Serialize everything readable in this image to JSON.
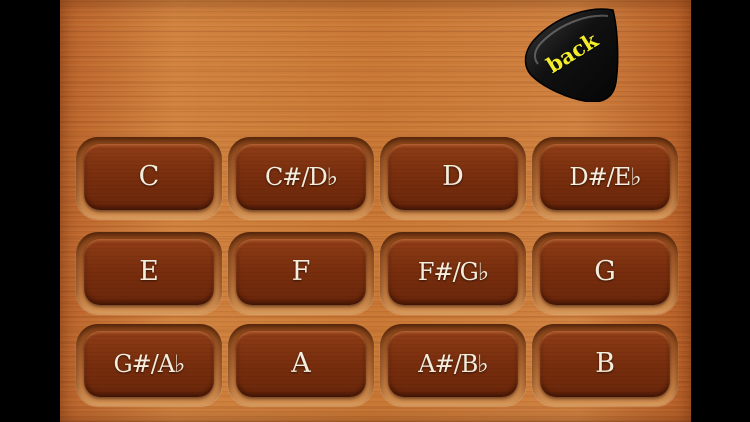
{
  "back_button": {
    "label": "back",
    "label_color": "#f2ec2c"
  },
  "note_keys": [
    {
      "label": "C"
    },
    {
      "label": "C#/D♭"
    },
    {
      "label": "D"
    },
    {
      "label": "D#/E♭"
    },
    {
      "label": "E"
    },
    {
      "label": "F"
    },
    {
      "label": "F#/G♭"
    },
    {
      "label": "G"
    },
    {
      "label": "G#/A♭"
    },
    {
      "label": "A"
    },
    {
      "label": "A#/B♭"
    },
    {
      "label": "B"
    }
  ],
  "colors": {
    "wood": "#c87734",
    "key": "#7a2f0e",
    "key_text": "#f4ecdc",
    "pick": "#111111"
  }
}
